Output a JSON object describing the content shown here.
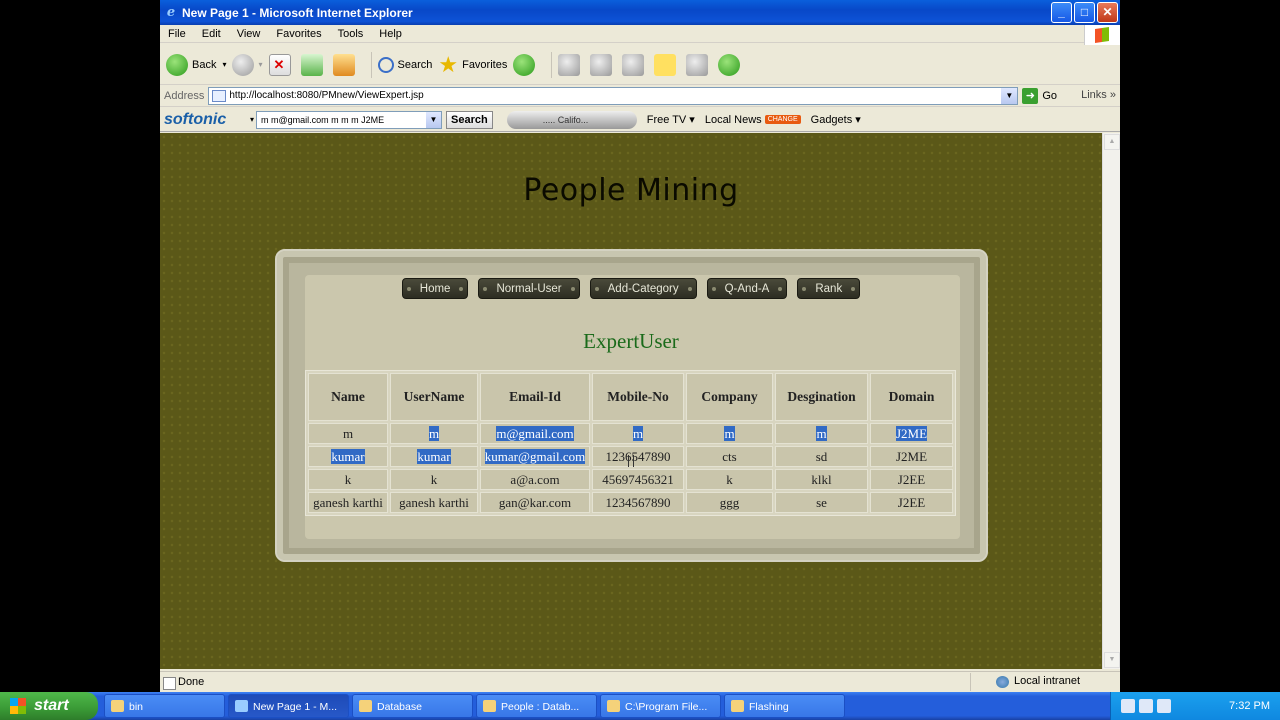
{
  "window": {
    "title": "New Page 1 - Microsoft Internet Explorer",
    "controls": [
      "_",
      "□",
      "✕"
    ]
  },
  "menu": [
    "File",
    "Edit",
    "View",
    "Favorites",
    "Tools",
    "Help"
  ],
  "toolbar": {
    "back": "Back",
    "search": "Search",
    "favorites": "Favorites"
  },
  "address": {
    "label": "Address",
    "url": "http://localhost:8080/PMnew/ViewExpert.jsp",
    "go": "Go",
    "links": "Links"
  },
  "softonic": {
    "brand": "softonic",
    "search_value": "m m@gmail.com m m m J2ME",
    "search_button": "Search",
    "radio": "..... Califo...",
    "free_tv": "Free TV",
    "local_news": "Local News",
    "change_badge": "CHANGE",
    "gadgets": "Gadgets"
  },
  "page": {
    "heading": "People Mining",
    "nav": [
      "Home",
      "Normal-User",
      "Add-Category",
      "Q-And-A",
      "Rank"
    ],
    "section_title": "ExpertUser",
    "table": {
      "headers": [
        "Name",
        "UserName",
        "Email-Id",
        "Mobile-No",
        "Company",
        "Desgination",
        "Domain"
      ],
      "rows": [
        [
          "m",
          "m",
          "m@gmail.com",
          "m",
          "m",
          "m",
          "J2ME"
        ],
        [
          "kumar",
          "kumar",
          "kumar@gmail.com",
          "1236547890",
          "cts",
          "sd",
          "J2ME"
        ],
        [
          "k",
          "k",
          "a@a.com",
          "45697456321",
          "k",
          "klkl",
          "J2EE"
        ],
        [
          "ganesh karthi",
          "ganesh karthi",
          "gan@kar.com",
          "1234567890",
          "ggg",
          "se",
          "J2EE"
        ]
      ]
    }
  },
  "status": {
    "text": "Done",
    "zone": "Local intranet"
  },
  "taskbar": {
    "start": "start",
    "tasks": [
      "bin",
      "New Page 1 - M...",
      "Database",
      "People : Datab...",
      "C:\\Program File...",
      "Flashing"
    ],
    "clock": "7:32 PM"
  },
  "colors": {
    "page_bg": "#5b5818",
    "panel_bg": "#cbc7ad",
    "section_title": "#1a6a1a",
    "selection": "#316ac5",
    "xp_blue": "#245edb"
  }
}
